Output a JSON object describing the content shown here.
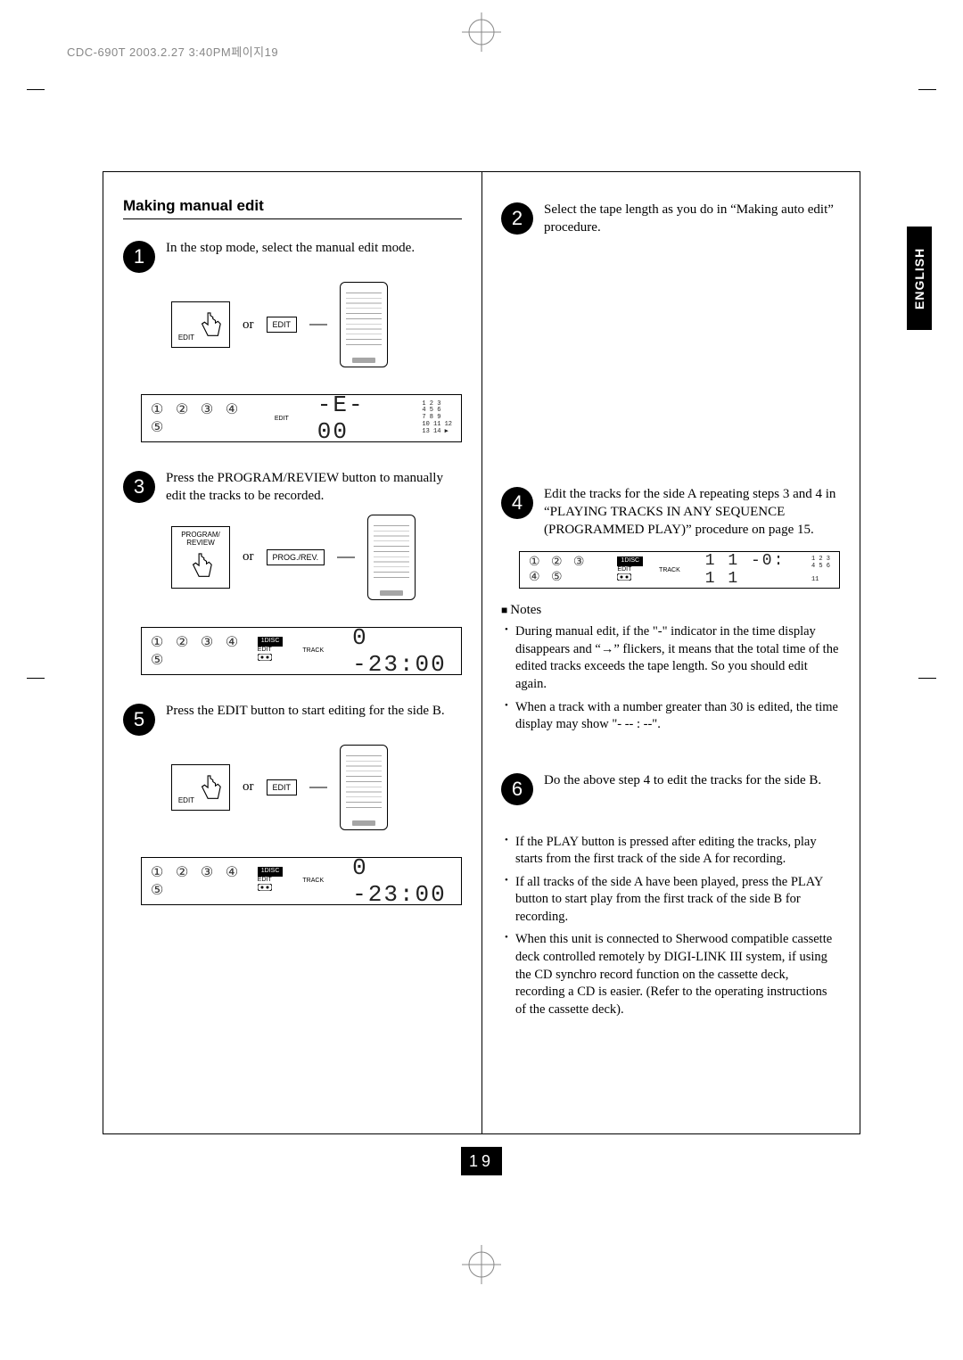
{
  "header": "CDC-690T  2003.2.27 3:40PM페이지19",
  "tab_label": "ENGLISH",
  "page_number": "19",
  "section_title": "Making manual edit",
  "or_label": "or",
  "button_labels": {
    "edit_panel": "EDIT",
    "edit_remote": "EDIT",
    "prog_panel": "PROGRAM/\nREVIEW",
    "prog_remote": "PROG./REV."
  },
  "displays": {
    "step1": {
      "discs": "① ② ③ ④ ⑤",
      "text": "-E-  00",
      "grid": "1 2 3\n4 5 6\n7 8 9\n10 11 12\n13 14 ▶"
    },
    "step3": {
      "discs": "① ② ③ ④ ⑤",
      "indic1": "1DISC",
      "indic2": "EDIT",
      "indic3": "TRACK",
      "text": "0  -23:00"
    },
    "step4": {
      "discs": "① ② ③ ④ ⑤",
      "indic1": "1DISC",
      "indic2": "EDIT",
      "indic3": "TRACK",
      "text": "1 1   -0: 1 1",
      "grid": "1 2 3\n4 5 6\n\n11"
    },
    "step5": {
      "discs": "① ② ③ ④ ⑤",
      "indic1": "1DISC",
      "indic2": "EDIT",
      "indic3": "TRACK",
      "text": "0  -23:00"
    }
  },
  "steps": {
    "1": "In the stop mode, select the manual edit mode.",
    "2": "Select the tape length as you do in “Making auto edit” procedure.",
    "3": "Press the PROGRAM/REVIEW button to manually edit the tracks to be recorded.",
    "4": "Edit the tracks for the side A repeating steps 3 and 4 in “PLAYING TRACKS IN ANY SEQUENCE (PROGRAMMED PLAY)”  procedure on page 15.",
    "5": "Press the EDIT button to start editing for the side B.",
    "6": "Do the above step 4 to edit the tracks for the side B."
  },
  "notes_heading": "Notes",
  "notes4": [
    "During manual edit, if the \"-\" indicator in the time display disappears and “→” flickers, it means that the total time of the edited tracks exceeds the tape length. So you should edit again.",
    "When a track with a number greater than 30 is edited, the time display may show \"- -- : --\"."
  ],
  "notes6": [
    "If the PLAY button is pressed after editing the tracks, play starts from the first track of the side A for recording.",
    "If all tracks of the side A have been played, press the PLAY button to start play from the first track of the side B for recording.",
    "When this unit is connected to Sherwood compatible cassette deck controlled remotely by DIGI-LINK III system, if using the CD synchro record function on the cassette deck, recording a CD is easier. (Refer to the operating instructions of the cassette deck)."
  ]
}
